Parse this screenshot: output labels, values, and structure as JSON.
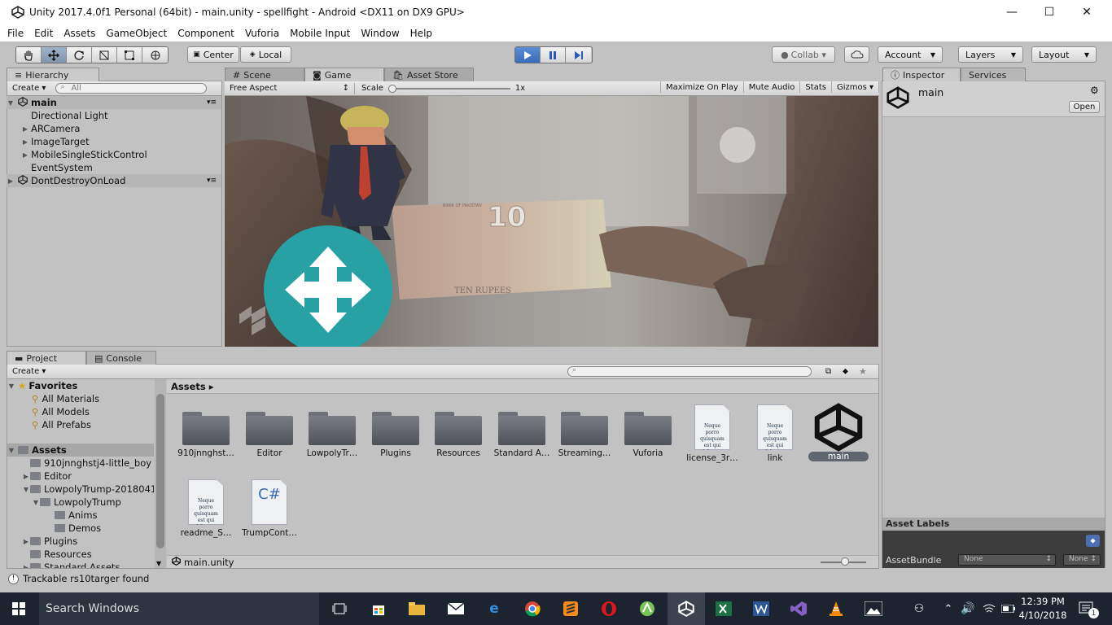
{
  "window": {
    "title": "Unity 2017.4.0f1 Personal (64bit) - main.unity - spellfight - Android <DX11 on DX9 GPU>",
    "minimize": "—",
    "maximize": "☐",
    "close": "✕"
  },
  "menu": [
    "File",
    "Edit",
    "Assets",
    "GameObject",
    "Component",
    "Vuforia",
    "Mobile Input",
    "Window",
    "Help"
  ],
  "toolbar": {
    "pivot": "Center",
    "space": "Local",
    "collab": "Collab ▾",
    "account": "Account",
    "layers": "Layers",
    "layout": "Layout",
    "play_state": "playing"
  },
  "hierarchy": {
    "tab": "Hierarchy",
    "create": "Create ▾",
    "search_placeholder": "All",
    "scene": "main",
    "items": [
      "Directional Light",
      "ARCamera",
      "ImageTarget",
      "MobileSingleStickControl",
      "EventSystem"
    ],
    "dont_destroy": "DontDestroyOnLoad"
  },
  "center_tabs": {
    "scene": "Scene",
    "game": "Game",
    "store": "Asset Store"
  },
  "game_view": {
    "aspect": "Free Aspect",
    "scale_label": "Scale",
    "scale_value": "1x",
    "maximize": "Maximize On Play",
    "mute": "Mute Audio",
    "stats": "Stats",
    "gizmos": "Gizmos ▾",
    "banknote_text": "TEN RUPEES",
    "banknote_number": "10",
    "banknote_header": "BANK OF PAKISTAN"
  },
  "inspector": {
    "tab": "Inspector",
    "services_tab": "Services",
    "object_name": "main",
    "open_button": "Open",
    "asset_labels": "Asset Labels",
    "asset_bundle": "AssetBundle",
    "bundle_none": "None",
    "variant_none": "None"
  },
  "project": {
    "tab": "Project",
    "console_tab": "Console",
    "create": "Create ▾",
    "favorites": "Favorites",
    "favorite_items": [
      "All Materials",
      "All Models",
      "All Prefabs"
    ],
    "assets_root": "Assets",
    "tree": [
      "910jnnghstj4-little_boy",
      "Editor",
      "LowpolyTrump-2018041",
      "LowpolyTrump",
      "Anims",
      "Demos",
      "Plugins",
      "Resources",
      "Standard Assets"
    ],
    "breadcrumb": "Assets ▸",
    "folders": [
      "910jnnghst…",
      "Editor",
      "LowpolyTr…",
      "Plugins",
      "Resources",
      "Standard A…",
      "Streaming…",
      "Vuforia"
    ],
    "docs": [
      "license_3r…",
      "link"
    ],
    "doc_preview_text": "Neque porro quisquam est qui dolorem.",
    "selected_asset": "main",
    "row2": [
      "readme_S…",
      "TrumpCont…"
    ],
    "csharp_glyph": "C#",
    "footer_path": "main.unity"
  },
  "status": {
    "message": "Trackable rs10targer found"
  },
  "taskbar": {
    "search": "Search Windows",
    "time": "12:39 PM",
    "date": "4/10/2018",
    "notifications": "1"
  }
}
